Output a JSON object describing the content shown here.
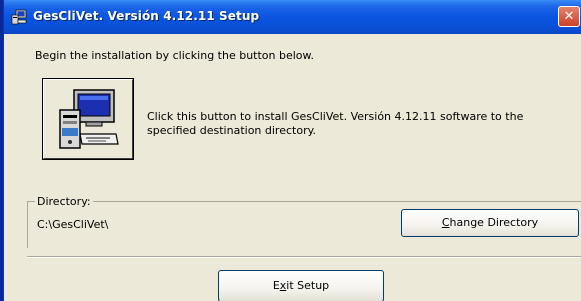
{
  "window": {
    "title": "GesCliVet. Versión 4.12.11 Setup",
    "close_glyph": "✕",
    "app_icon": "setup-computer-icon"
  },
  "intro_text": "Begin the installation by clicking the button below.",
  "install": {
    "icon": "install-computer-icon",
    "description": "Click this button to install GesCliVet. Versión 4.12.11 software to the specified destination directory."
  },
  "directory": {
    "legend": "Directory:",
    "path": "C:\\GesCliVet\\",
    "change_button": {
      "mnemonic": "C",
      "rest": "hange Directory"
    }
  },
  "exit_button": {
    "before": "E",
    "mnemonic": "x",
    "after": "it Setup"
  },
  "colors": {
    "titlebar": "#0a55e0",
    "dialog_bg": "#ece9d8",
    "desktop": "#0a2a8e",
    "close": "#cd4128"
  }
}
